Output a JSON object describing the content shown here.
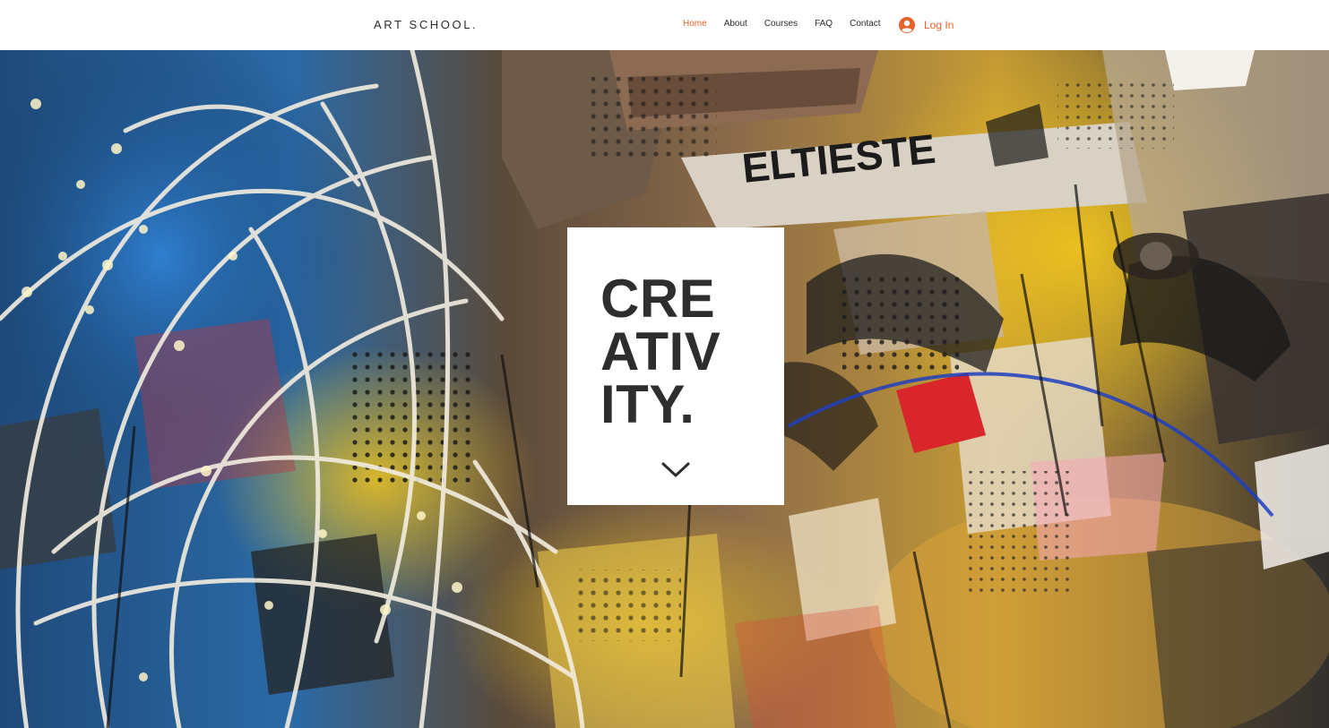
{
  "header": {
    "logo": "ART SCHOOL.",
    "nav": [
      {
        "label": "Home",
        "active": true
      },
      {
        "label": "About",
        "active": false
      },
      {
        "label": "Courses",
        "active": false
      },
      {
        "label": "FAQ",
        "active": false
      },
      {
        "label": "Contact",
        "active": false
      }
    ],
    "login_label": "Log In",
    "login_icon": "user-avatar-icon"
  },
  "hero": {
    "background": "abstract-collage-artwork",
    "headline_lines": [
      "CRE",
      "ATIV",
      "ITY."
    ],
    "scroll_icon": "chevron-down-icon"
  },
  "colors": {
    "accent": "#e8632a",
    "text": "#2b2b2b",
    "headline": "#2f2d2d",
    "card_bg": "#ffffff"
  }
}
